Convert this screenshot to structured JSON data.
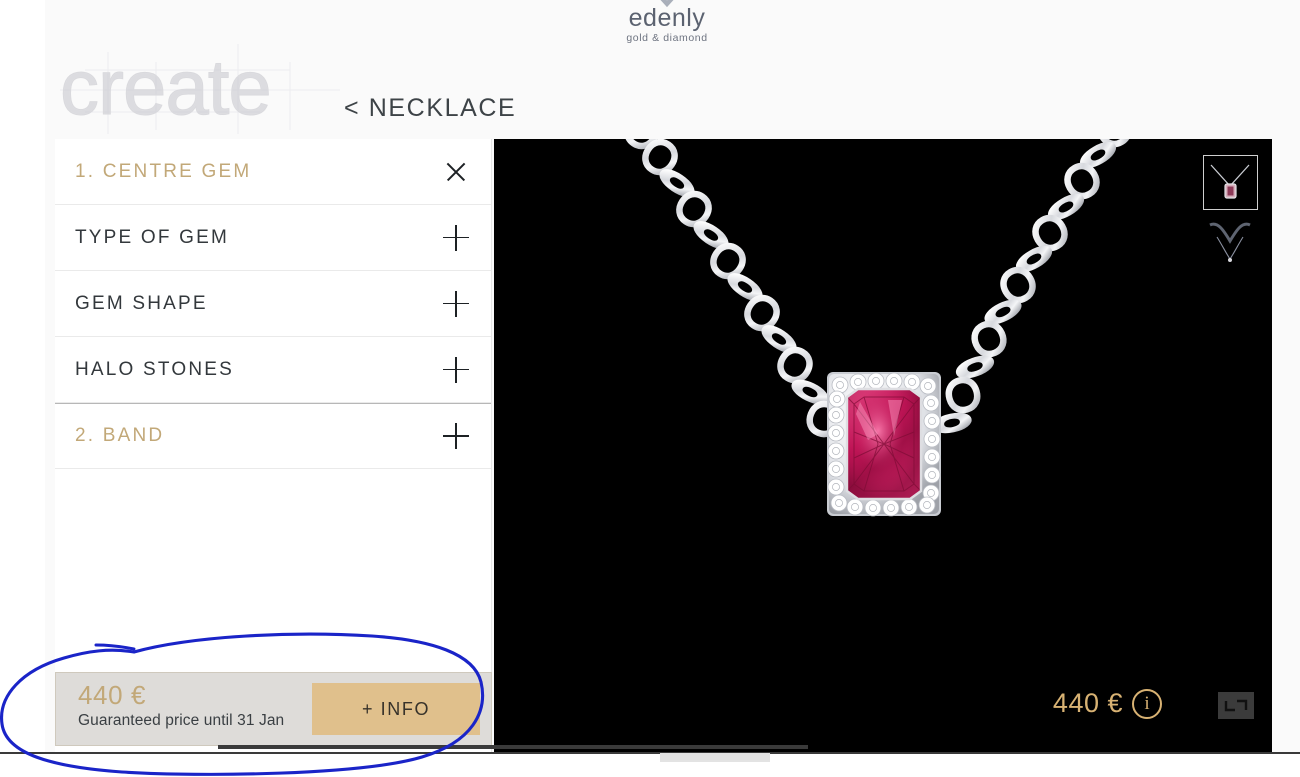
{
  "brand": {
    "name": "edenly",
    "tagline": "gold & diamond",
    "mark": "diamond-heart-mark"
  },
  "header": {
    "watermark": "create",
    "back_link": "< NECKLACE"
  },
  "config_panel": {
    "rows": [
      {
        "label": "1. CENTRE GEM",
        "style": "gold",
        "icon": "close-icon",
        "expanded": true
      },
      {
        "label": "TYPE OF GEM",
        "style": "dark",
        "icon": "plus-icon",
        "expanded": false
      },
      {
        "label": "GEM SHAPE",
        "style": "dark",
        "icon": "plus-icon",
        "expanded": false
      },
      {
        "label": "HALO STONES",
        "style": "dark",
        "icon": "plus-icon",
        "expanded": false
      },
      {
        "label": "2. BAND",
        "style": "gold",
        "icon": "plus-icon",
        "expanded": false
      }
    ]
  },
  "price_bar": {
    "price": "440 €",
    "note": "Guaranteed price until 31 Jan",
    "info_button": "+ INFO"
  },
  "viewer": {
    "price": "440 €",
    "info_icon_label": "i",
    "fullscreen_icon": "fullscreen-icon",
    "thumbnails": [
      {
        "name": "necklace-front-view",
        "selected": true
      },
      {
        "name": "necklace-angle-view",
        "selected": false
      }
    ],
    "product": {
      "type": "necklace",
      "gem_color": "#c2185b",
      "metal_color": "#e8e8ec",
      "background": "#000000"
    }
  },
  "annotation": {
    "type": "hand-drawn-ellipse",
    "color": "#1a24c8",
    "target": "price-bar"
  },
  "colors": {
    "gold": "#c2a878",
    "button_gold": "#e0c08c",
    "viewer_gold": "#d8b273",
    "text_dark": "#33383c",
    "panel_bg": "#dedcd9"
  }
}
